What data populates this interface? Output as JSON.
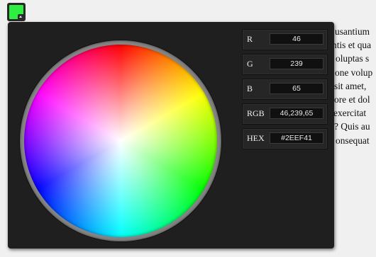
{
  "swatch": {
    "color": "#2EEF41"
  },
  "background_text": [
    "usantium",
    "ntis et qua",
    "oluptas s",
    "one volup",
    "sit amet,",
    "ore et dol",
    " exercitat",
    "? Quis au",
    "onsequat"
  ],
  "picker": {
    "fields": [
      {
        "label": "R",
        "value": "46"
      },
      {
        "label": "G",
        "value": "239"
      },
      {
        "label": "B",
        "value": "65"
      },
      {
        "label": "RGB",
        "value": "46,239,65"
      },
      {
        "label": "HEX",
        "value": "#2EEF41"
      }
    ]
  }
}
